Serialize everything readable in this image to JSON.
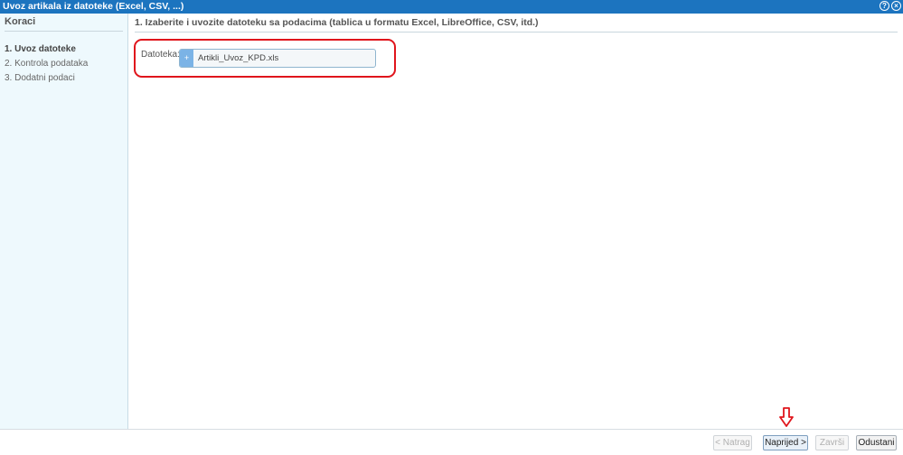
{
  "window": {
    "title": "Uvoz artikala iz datoteke (Excel, CSV, ...)",
    "help_icon": "?",
    "close_icon": "×"
  },
  "sidebar": {
    "title": "Koraci",
    "steps": [
      {
        "label": "1. Uvoz datoteke",
        "active": true
      },
      {
        "label": "2. Kontrola podataka",
        "active": false
      },
      {
        "label": "3. Dodatni podaci",
        "active": false
      }
    ]
  },
  "main": {
    "title": "1. Izaberite i uvozite datoteku sa podacima (tablica u formatu Excel, LibreOffice, CSV, itd.)",
    "file_field": {
      "label": "Datoteka:",
      "button_icon": "+",
      "value": "Artikli_Uvoz_KPD.xls"
    }
  },
  "footer": {
    "back_label": "< Natrag",
    "next_label": "Naprijed >",
    "finish_label": "Završi",
    "cancel_label": "Odustani"
  },
  "colors": {
    "titlebar": "#1c74bf",
    "highlight": "#e0151c",
    "sidebar_bg": "#eef9fd"
  }
}
